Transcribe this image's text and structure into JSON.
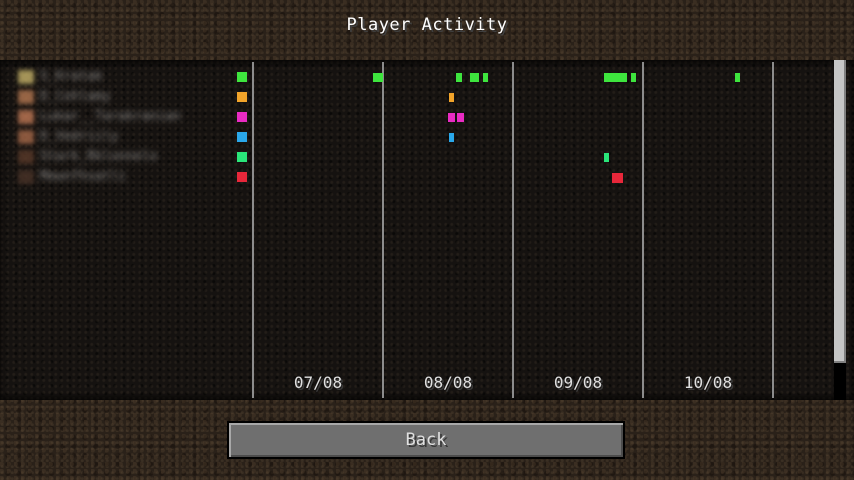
{
  "screen": {
    "title": "Player Activity"
  },
  "players": [
    {
      "name": "S_Kratak",
      "color": "#3ee53e",
      "head_color": "#c8b46a"
    },
    {
      "name": "D_Cohlamy",
      "color": "#f2a42a",
      "head_color": "#b87a52"
    },
    {
      "name": "Lukar__Tarakranian",
      "color": "#ea2bc3",
      "head_color": "#c27a56"
    },
    {
      "name": "D_Vedriily",
      "color": "#2aa8ea",
      "head_color": "#a86a4a"
    },
    {
      "name": "Stark_Rklonnelo",
      "color": "#2ae67a",
      "head_color": "#5a3a2a"
    },
    {
      "name": "Mewnfhsatli",
      "color": "#e8273a",
      "head_color": "#4a3328"
    }
  ],
  "timeline": {
    "dates": [
      "07/08",
      "08/08",
      "09/08",
      "10/08"
    ],
    "activity": [
      {
        "player": 0,
        "day": 0,
        "start": 0.92,
        "end": 1.0
      },
      {
        "player": 0,
        "day": 1,
        "start": 0.56,
        "end": 0.61
      },
      {
        "player": 0,
        "day": 1,
        "start": 0.67,
        "end": 0.74
      },
      {
        "player": 0,
        "day": 1,
        "start": 0.77,
        "end": 0.81
      },
      {
        "player": 0,
        "day": 2,
        "start": 0.7,
        "end": 0.88
      },
      {
        "player": 0,
        "day": 2,
        "start": 0.91,
        "end": 0.95
      },
      {
        "player": 0,
        "day": 3,
        "start": 0.71,
        "end": 0.75
      },
      {
        "player": 1,
        "day": 1,
        "start": 0.51,
        "end": 0.55
      },
      {
        "player": 2,
        "day": 1,
        "start": 0.5,
        "end": 0.55
      },
      {
        "player": 2,
        "day": 1,
        "start": 0.57,
        "end": 0.62
      },
      {
        "player": 3,
        "day": 1,
        "start": 0.51,
        "end": 0.55
      },
      {
        "player": 4,
        "day": 2,
        "start": 0.7,
        "end": 0.74
      },
      {
        "player": 5,
        "day": 2,
        "start": 0.76,
        "end": 0.85
      }
    ]
  },
  "scrollbar": {
    "thumb_fraction": 0.89
  },
  "buttons": {
    "back_label": "Back"
  }
}
